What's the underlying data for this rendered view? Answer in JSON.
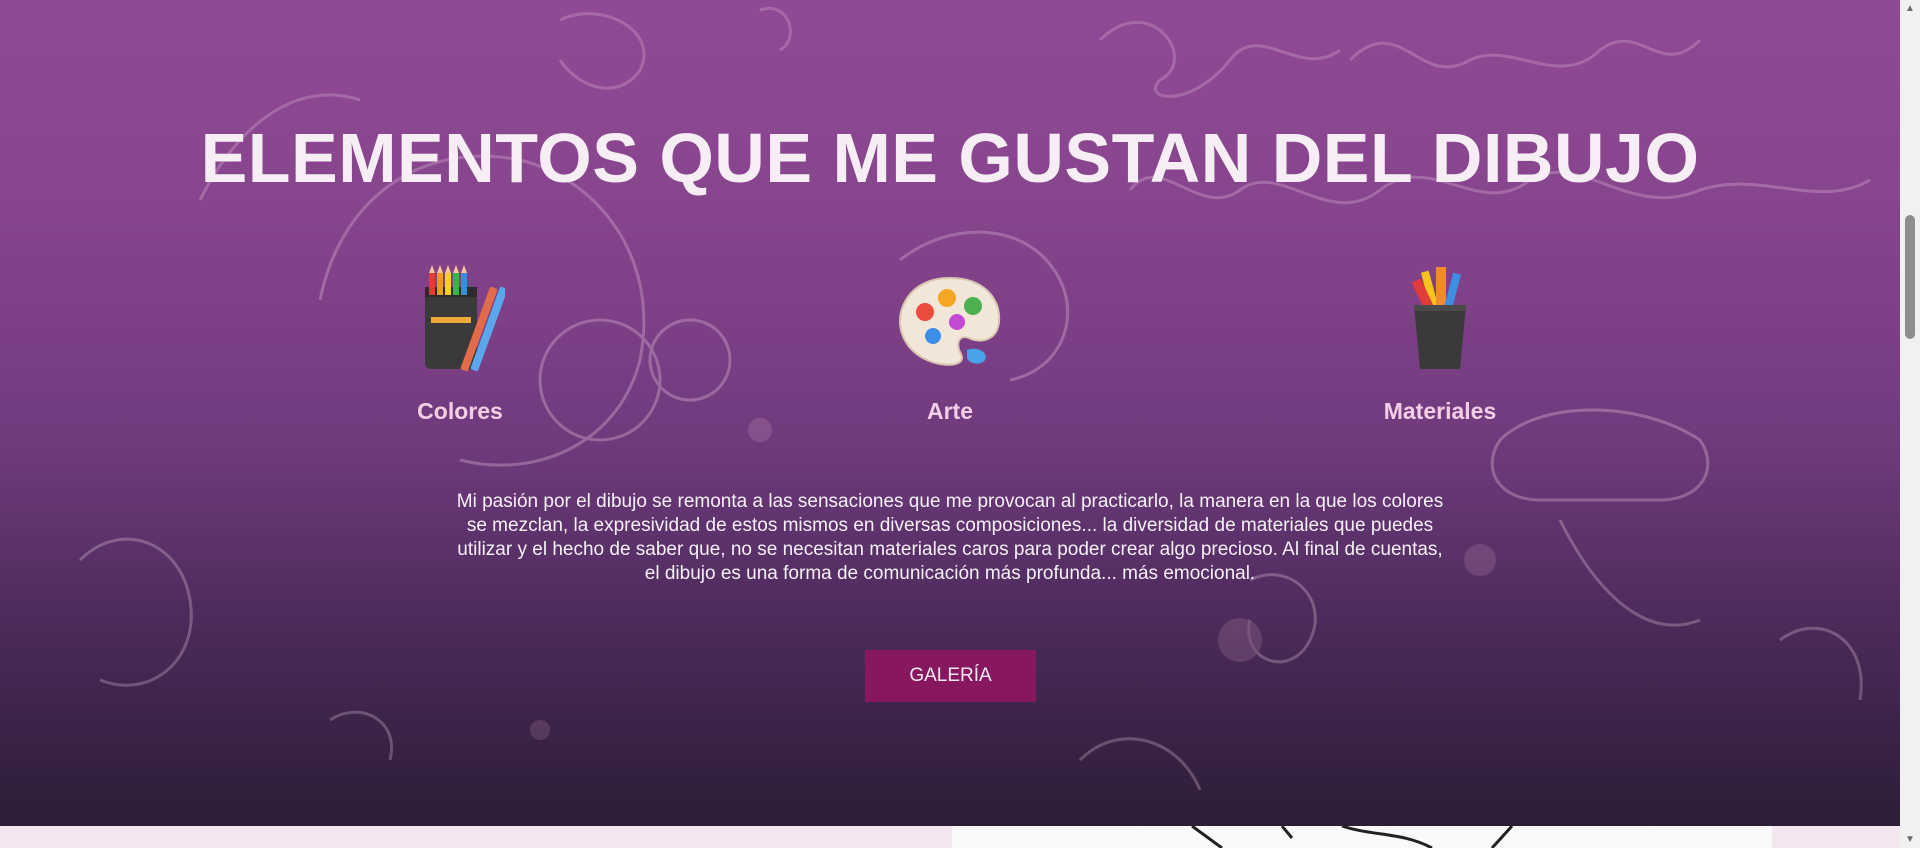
{
  "section": {
    "title": "ELEMENTOS QUE ME GUSTAN DEL DIBUJO",
    "features": [
      {
        "label": "Colores",
        "icon": "colored-pencils-icon"
      },
      {
        "label": "Arte",
        "icon": "paint-palette-icon"
      },
      {
        "label": "Materiales",
        "icon": "art-supplies-cup-icon"
      }
    ],
    "description": "Mi pasión por el dibujo se remonta a las sensaciones que me provocan al practicarlo, la manera en la que los colores se mezclan, la expresividad de estos mismos en diversas composiciones... la diversidad de materiales que puedes utilizar y el hecho de saber que, no se necesitan materiales caros para poder crear algo precioso. Al final de cuentas, el dibujo es una forma de comunicación más profunda... más emocional.",
    "button_label": "GALERÍA"
  },
  "colors": {
    "hero_purple": "#8e4a94",
    "button_bg": "#87185f",
    "feature_label": "#f3cfe5"
  }
}
